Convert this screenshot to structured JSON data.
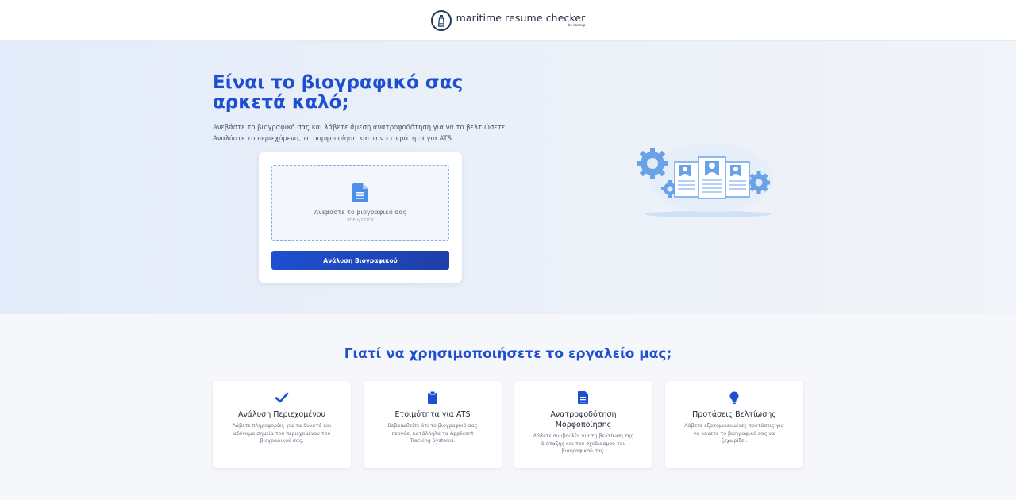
{
  "header": {
    "brand_name": "maritime resume checker",
    "brand_sub": "by kastrup"
  },
  "hero": {
    "title": "Είναι το βιογραφικό σας αρκετά καλό;",
    "description": "Ανεβάστε το βιογραφικό σας και λάβετε άμεση ανατροφοδότηση για να το βελτιώσετε. Αναλύστε το περιεχόμενο, τη μορφοποίηση και την ετοιμότητα για ATS."
  },
  "upload": {
    "label": "Ανεβάστε το βιογραφικό σας",
    "formats": "PDF ή DOCX",
    "button": "Ανάλυση Βιογραφικού"
  },
  "why": {
    "title": "Γιατί να χρησιμοποιήσετε το εργαλείο μας;"
  },
  "features": [
    {
      "icon": "check-icon",
      "title": "Ανάλυση Περιεχομένου",
      "desc": "Λάβετε πληροφορίες για τα δυνατά και αδύναμα σημεία του περιεχομένου του βιογραφικού σας."
    },
    {
      "icon": "clipboard-icon",
      "title": "Ετοιμότητα για ATS",
      "desc": "Βεβαιωθείτε ότι το βιογραφικό σας περνάει κατάλληλα τα Applicant Tracking Systems."
    },
    {
      "icon": "document-icon",
      "title": "Ανατροφοδότηση Μορφοποίησης",
      "desc": "Λάβετε συμβουλές για τη βελτίωση της διάταξης και του σχεδιασμού του βιογραφικού σας."
    },
    {
      "icon": "lightbulb-icon",
      "title": "Προτάσεις Βελτίωσης",
      "desc": "Λάβετε εξατομικευμένες προτάσεις για να κάνετε το βιογραφικό σας να ξεχωρίζει."
    }
  ],
  "colors": {
    "accent": "#1e4fd0",
    "button_start": "#1e4fd0",
    "button_end": "#1f3fa8",
    "hero_bg": "#e6eef9"
  }
}
